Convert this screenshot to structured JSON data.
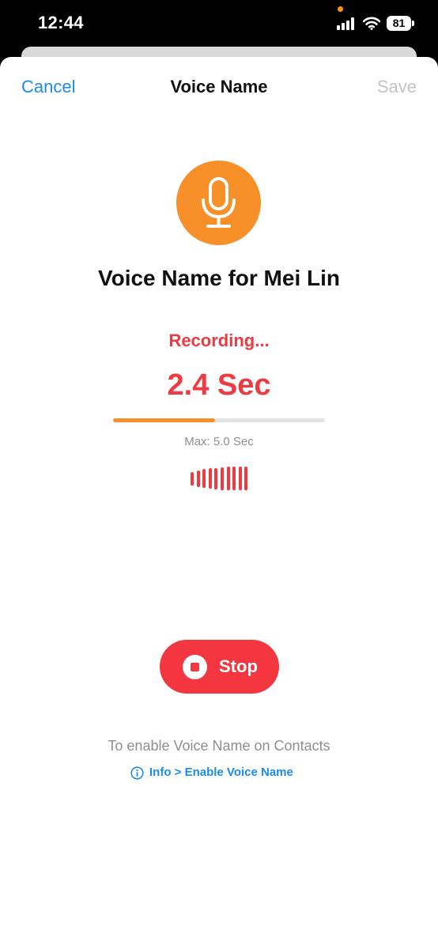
{
  "status_bar": {
    "time": "12:44",
    "battery": "81",
    "icons": [
      "cellular-signal-icon",
      "wifi-icon",
      "battery-icon"
    ]
  },
  "nav": {
    "cancel_label": "Cancel",
    "title": "Voice Name",
    "save_label": "Save"
  },
  "recorder": {
    "icon": "microphone-icon",
    "contact_title": "Voice Name for Mei Lin",
    "status": "Recording...",
    "elapsed": "2.4 Sec",
    "progress_percent": 48,
    "max_label": "Max: 5.0 Sec",
    "waveform_levels": [
      0.55,
      0.7,
      0.8,
      0.85,
      0.9,
      0.95,
      1.0,
      1.0,
      1.0,
      1.0
    ]
  },
  "stop_button": {
    "label": "Stop",
    "icon": "stop-icon"
  },
  "footer": {
    "hint": "To enable Voice Name on Contacts",
    "link_label": "Info > Enable Voice Name",
    "link_icon": "info-icon"
  },
  "colors": {
    "accent_blue": "#1a8cf0",
    "mic_orange": "#f8902a",
    "recording_red": "#ec3c42",
    "stop_red": "#f3363f",
    "disabled_gray": "#c4c4c6"
  }
}
